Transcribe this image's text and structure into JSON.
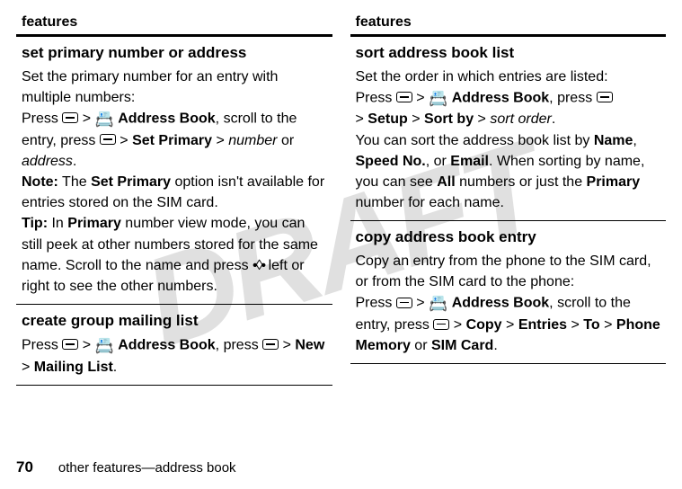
{
  "watermark": "DRAFT",
  "left": {
    "header": "features",
    "cells": [
      {
        "heading": "set primary number or address",
        "body": "Set the primary number for an entry with multiple numbers:",
        "nav": {
          "pre": "Press ",
          "ab": "Address Book",
          "mid": ", scroll to the entry, press ",
          "setprimary": "Set Primary",
          "post_gt": " > ",
          "num": "number",
          "or": " or ",
          "addr": "address",
          "dot": "."
        },
        "note_label": "Note:",
        "note_body": " The ",
        "note_sp": "Set Primary",
        "note_rest": " option isn't available for entries stored on the SIM card.",
        "tip_label": "Tip:",
        "tip_pre": " In ",
        "tip_primary": "Primary",
        "tip_rest": " number view mode, you can still peek at other numbers stored for the same name. Scroll to the name and press ",
        "tip_end": " left or right to see the other numbers."
      },
      {
        "heading": "create group mailing list",
        "pre": "Press ",
        "ab": "Address Book",
        "mid": ", press ",
        "new": "New",
        "ml": "Mailing List",
        "dot": "."
      }
    ]
  },
  "right": {
    "header": "features",
    "cells": [
      {
        "heading": "sort address book list",
        "body": "Set the order in which entries are listed:",
        "pre": "Press ",
        "ab": "Address Book",
        "mid": ", press ",
        "setup": "Setup",
        "sortby": "Sort by",
        "sortorder": "sort order",
        "dot": ".",
        "extra_pre": "You can sort the address book list by ",
        "name": "Name",
        "comma": ", ",
        "speedno": "Speed No.",
        "or": ", or ",
        "email": "Email",
        "extra_mid": ". When sorting by name, you can see ",
        "all": "All",
        "extra_mid2": " numbers or just the ",
        "primary": "Primary",
        "extra_end": " number for each name."
      },
      {
        "heading": "copy address book entry",
        "body": "Copy an entry from the phone to the SIM card, or from the SIM card to the phone:",
        "pre": "Press ",
        "ab": "Address Book",
        "mid": ", scroll to the entry, press ",
        "copy": "Copy",
        "entries": "Entries",
        "to": "To",
        "pm": "Phone Memory",
        "or": " or ",
        "sim": "SIM Card",
        "dot": "."
      }
    ]
  },
  "footer": {
    "page": "70",
    "text": "other features—address book"
  }
}
